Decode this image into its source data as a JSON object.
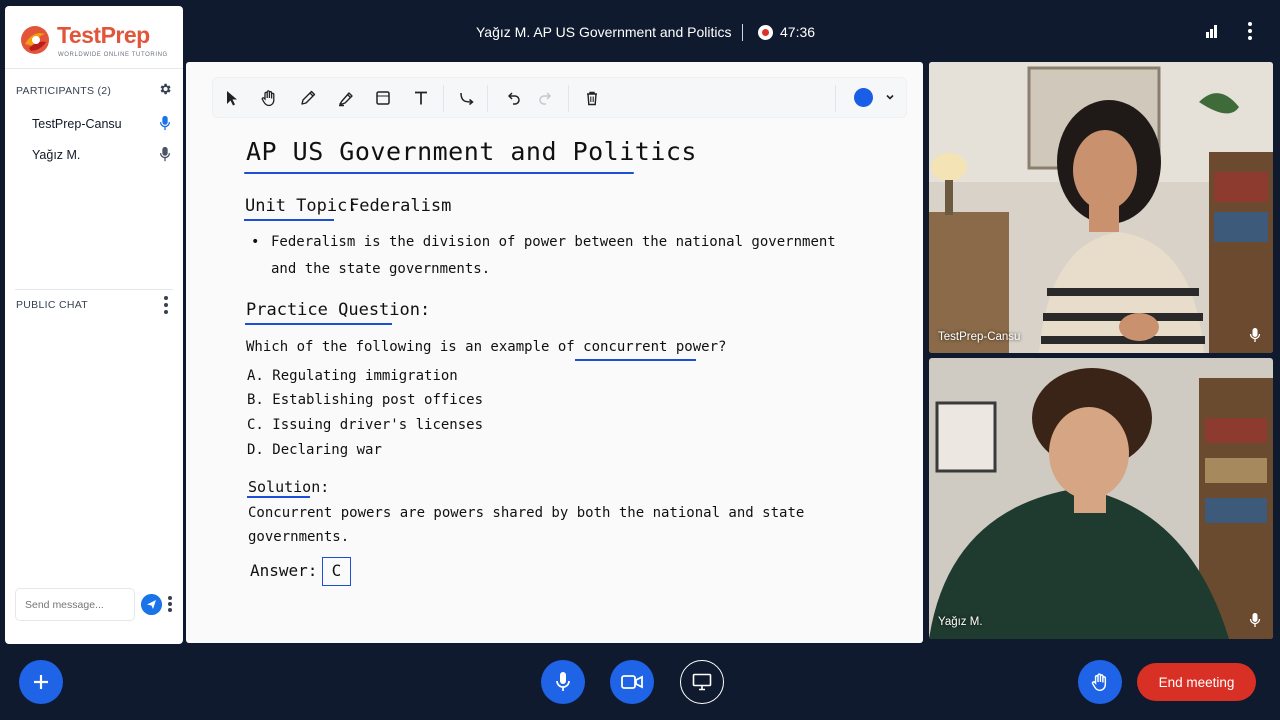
{
  "header": {
    "meeting_title": "Yağız M. AP US Government and Politics",
    "recording_time": "47:36"
  },
  "brand": {
    "name": "TestPrep",
    "tagline": "WORLDWIDE ONLINE TUTORING"
  },
  "sidebar": {
    "participants_heading": "PARTICIPANTS (2)",
    "participants": [
      {
        "name": "TestPrep-Cansu",
        "mic": "active"
      },
      {
        "name": "Yağız M.",
        "mic": "idle"
      }
    ],
    "chat_heading": "PUBLIC CHAT",
    "message_placeholder": "Send message..."
  },
  "whiteboard": {
    "tools": [
      "select-tool",
      "pan-tool",
      "pencil-tool",
      "highlighter-tool",
      "shape-tool",
      "text-tool",
      "connector-tool",
      "undo",
      "redo",
      "delete"
    ],
    "selected_color": "#1a5ee8",
    "title": "AP US Government and Politics",
    "unit_label": "Unit Topic:",
    "unit_value": "Federalism",
    "bullet_line1": "Federalism is the division of power between the national government",
    "bullet_line2": "and the state governments.",
    "practice_label": "Practice Question:",
    "question_prefix": "Which of the following is an example of ",
    "question_term": "concurrent power",
    "question_suffix": "?",
    "options": [
      {
        "letter": "A.",
        "text": "Regulating immigration"
      },
      {
        "letter": "B.",
        "text": "Establishing post offices"
      },
      {
        "letter": "C.",
        "text": "Issuing driver's licenses"
      },
      {
        "letter": "D.",
        "text": "Declaring war"
      }
    ],
    "solution_label": "Solution:",
    "solution_line1": "Concurrent powers are powers shared by both the national and state",
    "solution_line2": "governments.",
    "answer_label": "Answer:",
    "answer_value": "C"
  },
  "videos": [
    {
      "name": "TestPrep-Cansu"
    },
    {
      "name": "Yağız M."
    }
  ],
  "controls": {
    "end_meeting_label": "End meeting"
  },
  "colors": {
    "brand_orange": "#e2553a",
    "accent_blue": "#1a73e8",
    "control_blue": "#1f63e6",
    "end_red": "#d93025",
    "ink_blue": "#1d4fd6",
    "page_bg": "#0f1a2e"
  }
}
